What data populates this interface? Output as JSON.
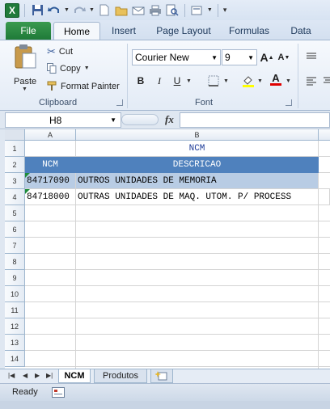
{
  "ribbon": {
    "tabs": {
      "file": "File",
      "home": "Home",
      "insert": "Insert",
      "page_layout": "Page Layout",
      "formulas": "Formulas",
      "data": "Data"
    },
    "clipboard": {
      "paste": "Paste",
      "cut": "Cut",
      "copy": "Copy",
      "format_painter": "Format Painter",
      "label": "Clipboard"
    },
    "font": {
      "name": "Courier New",
      "size": "9",
      "label": "Font",
      "grow": "A",
      "shrink": "A",
      "bold": "B",
      "italic": "I",
      "underline": "U",
      "font_color": "A"
    }
  },
  "formula_bar": {
    "name_box": "H8",
    "fx": "fx",
    "value": ""
  },
  "grid": {
    "columns": [
      "A",
      "B"
    ],
    "row_numbers": [
      "1",
      "2",
      "3",
      "4",
      "5",
      "6",
      "7",
      "8",
      "9",
      "10",
      "11",
      "12",
      "13",
      "14"
    ],
    "title": "NCM",
    "headers": {
      "a": "NCM",
      "b": "DESCRICAO"
    },
    "rows": [
      {
        "ncm": "84717090",
        "descricao": "OUTROS UNIDADES DE MEMORIA"
      },
      {
        "ncm": "84718000",
        "descricao": "OUTRAS UNIDADES DE MAQ. UTOM. P/ PROCESS"
      }
    ]
  },
  "sheets": {
    "active": "NCM",
    "other": "Produtos"
  },
  "status": {
    "ready": "Ready"
  },
  "colors": {
    "header_fill": "#4f81bd",
    "band_fill": "#b8cce4",
    "title_color": "#1f3d99",
    "file_tab": "#2a8a43"
  }
}
